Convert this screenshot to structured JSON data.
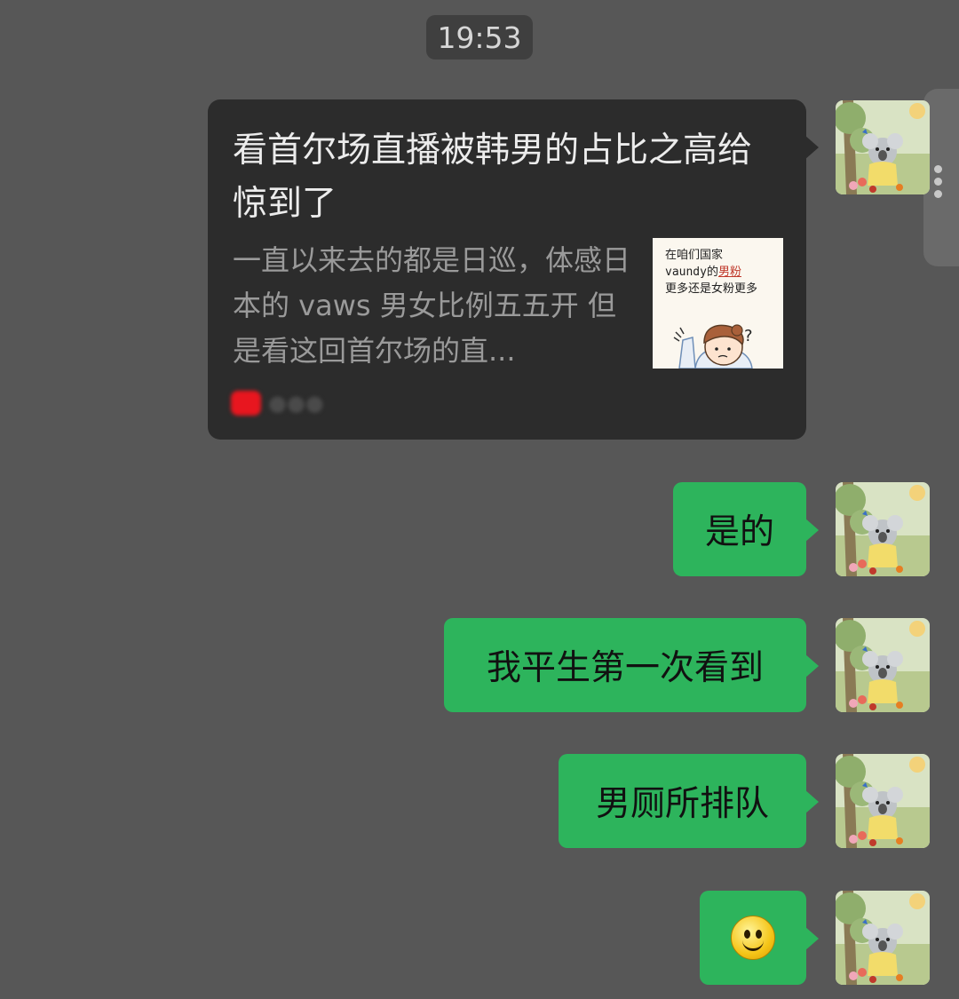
{
  "chat": {
    "timestamp": "19:53",
    "link_card": {
      "title": "看首尔场直播被韩男的占比之高给惊到了",
      "description": "一直以来去的都是日巡，体感日本的 vaws 男女比例五五开 但是看这回首尔场的直...",
      "thumbnail": {
        "line1": "在咱们国家",
        "line2_prefix": "vaundy的",
        "line2_highlight": "男粉",
        "line3": "更多还是女粉更多"
      },
      "source_icon": "red-app-icon"
    },
    "messages": [
      {
        "text": "是的"
      },
      {
        "text": "我平生第一次看到"
      },
      {
        "text": "男厕所排队"
      },
      {
        "emoji": "smile-emoji"
      }
    ],
    "colors": {
      "background": "#575757",
      "bubble_green": "#2db45c",
      "card_bg": "#2c2c2c"
    }
  }
}
